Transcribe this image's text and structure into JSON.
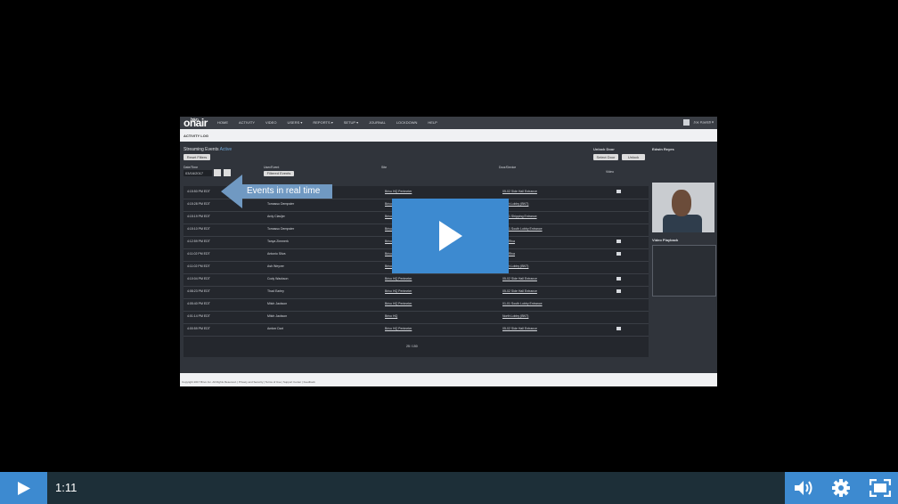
{
  "app": {
    "logo_top": "brivo",
    "logo_main": "onair",
    "nav": [
      "HOME",
      "ACTIVITY",
      "VIDEO",
      "USERS ▾",
      "REPORTS ▾",
      "SETUP ▾",
      "JOURNAL",
      "LOCKDOWN",
      "HELP"
    ],
    "user_name": "Joe Kaelsti ▾",
    "subtitle": "ACTIVITY LOG",
    "section_title": "Streaming Events",
    "section_status": "Active",
    "reset_label": "Reset Filters",
    "date_label": "Date/Time",
    "date_value": "03/16/2017",
    "user_event_label": "User/Event",
    "user_event_button": "Filtered Events",
    "site_label": "Site",
    "door_label": "Door/Device",
    "unlock_title": "Unlock Door",
    "select_door": "Select Door",
    "unlock_btn": "Unlock",
    "video_col": "Video",
    "person_name": "Edwin Reyes",
    "video_playback": "Video Playback",
    "pager": "25 / 150",
    "footer": "Copyright 2017 Brivo Inc. All Rights Reserved. | Privacy and Security | Terms of Use | Support Center | Feedback"
  },
  "rows": [
    {
      "time": "4:15:50 PM EDT",
      "user": "Edwin Reyes",
      "site": "Brivo HQ Perimeter",
      "door": "05-02 Side Hall Entrance"
    },
    {
      "time": "4:15:28 PM EDT",
      "user": "Tomasso Dempster",
      "site": "Brivo HQ",
      "door": "North Lobby (BNT)"
    },
    {
      "time": "4:15:19 PM EDT",
      "user": "Ardy Clavijer",
      "site": "Brivo HQ Perimeter",
      "door": "01-01 Shipping Entrance"
    },
    {
      "time": "4:15:10 PM EDT",
      "user": "Tomasso Dempster",
      "site": "Brivo HQ Perimeter",
      "door": "01-01 South Lobby Entrance"
    },
    {
      "time": "4:12:59 PM EDT",
      "user": "Tanya Zimmerk",
      "site": "Brivo HQ",
      "door": "Bas Riva"
    },
    {
      "time": "4:11:02 PM EDT",
      "user": "Antonio Silva",
      "site": "Brivo HQ",
      "door": "Bas Riva"
    },
    {
      "time": "4:11:02 PM EDT",
      "user": "Ash Weyver",
      "site": "Brivo HQ",
      "door": "North Lobby (BNT)"
    },
    {
      "time": "4:10:04 PM EDT",
      "user": "Cody Wackson",
      "site": "Brivo HQ Perimeter",
      "door": "05-02 Side Hall Entrance"
    },
    {
      "time": "4:08:23 PM EDT",
      "user": "Thad Earley",
      "site": "Brivo HQ Perimeter",
      "door": "05-02 Side Hall Entrance"
    },
    {
      "time": "4:05:40 PM EDT",
      "user": "Mitch Jackson",
      "site": "Brivo HQ Perimeter",
      "door": "01-01 South Lobby Entrance"
    },
    {
      "time": "4:01:14 PM EDT",
      "user": "Mitch Jackson",
      "site": "Brivo HQ",
      "door": "North Lobby (BNT)"
    },
    {
      "time": "4:00:59 PM EDT",
      "user": "Amber Dart",
      "site": "Brivo HQ Perimeter",
      "door": "05-02 Side Hall Entrance"
    }
  ],
  "overlay": {
    "banner_text": "Events in real time"
  },
  "player": {
    "time": "1:11",
    "accent": "#3d8ad0",
    "bar_color": "#1d2f38"
  }
}
